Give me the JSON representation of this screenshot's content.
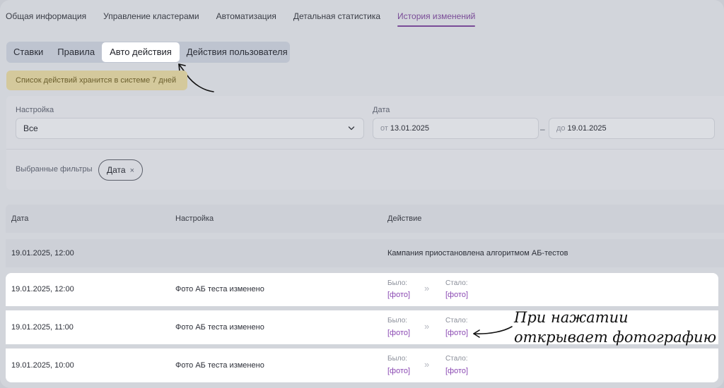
{
  "top_tabs": [
    {
      "label": "Общая информация",
      "active": false
    },
    {
      "label": "Управление кластерами",
      "active": false
    },
    {
      "label": "Автоматизация",
      "active": false
    },
    {
      "label": "Детальная статистика",
      "active": false
    },
    {
      "label": "История изменений",
      "active": true
    }
  ],
  "segment": {
    "items": [
      "Ставки",
      "Правила",
      "Авто действия",
      "Действия пользователя"
    ],
    "active": "Авто действия"
  },
  "notice": "Список действий хранится в системе 7 дней",
  "filters": {
    "setting_label": "Настройка",
    "setting_value": "Все",
    "date_label": "Дата",
    "from_prefix": "от",
    "from_value": "13.01.2025",
    "to_prefix": "до",
    "to_value": "19.01.2025",
    "dash": "–",
    "selected_label": "Выбранные фильтры",
    "chip": "Дата",
    "chip_close": "×"
  },
  "table": {
    "headers": [
      "Дата",
      "Настройка",
      "Действие"
    ],
    "rows": [
      {
        "date": "19.01.2025, 12:00",
        "setting": "",
        "action": "Кампания приостановлена алгоритмом АБ-тестов"
      },
      {
        "date": "19.01.2025, 12:00",
        "setting": "Фото АБ теста изменено",
        "before_label": "Было:",
        "before": "[фото]",
        "after_label": "Стало:",
        "after": "[фото]"
      },
      {
        "date": "19.01.2025, 11:00",
        "setting": "Фото АБ теста изменено",
        "before_label": "Было:",
        "before": "[фото]",
        "after_label": "Стало:",
        "after": "[фото]"
      },
      {
        "date": "19.01.2025, 10:00",
        "setting": "Фото АБ теста изменено",
        "before_label": "Было:",
        "before": "[фото]",
        "after_label": "Стало:",
        "after": "[фото]"
      }
    ],
    "arrows": "»"
  },
  "annotation": {
    "line1": "При нажатии",
    "line2": "открывает фотографию"
  },
  "colors": {
    "accent": "#7a4c97",
    "photo_link": "#8b4ab3",
    "notice_bg": "#d4c99c"
  }
}
